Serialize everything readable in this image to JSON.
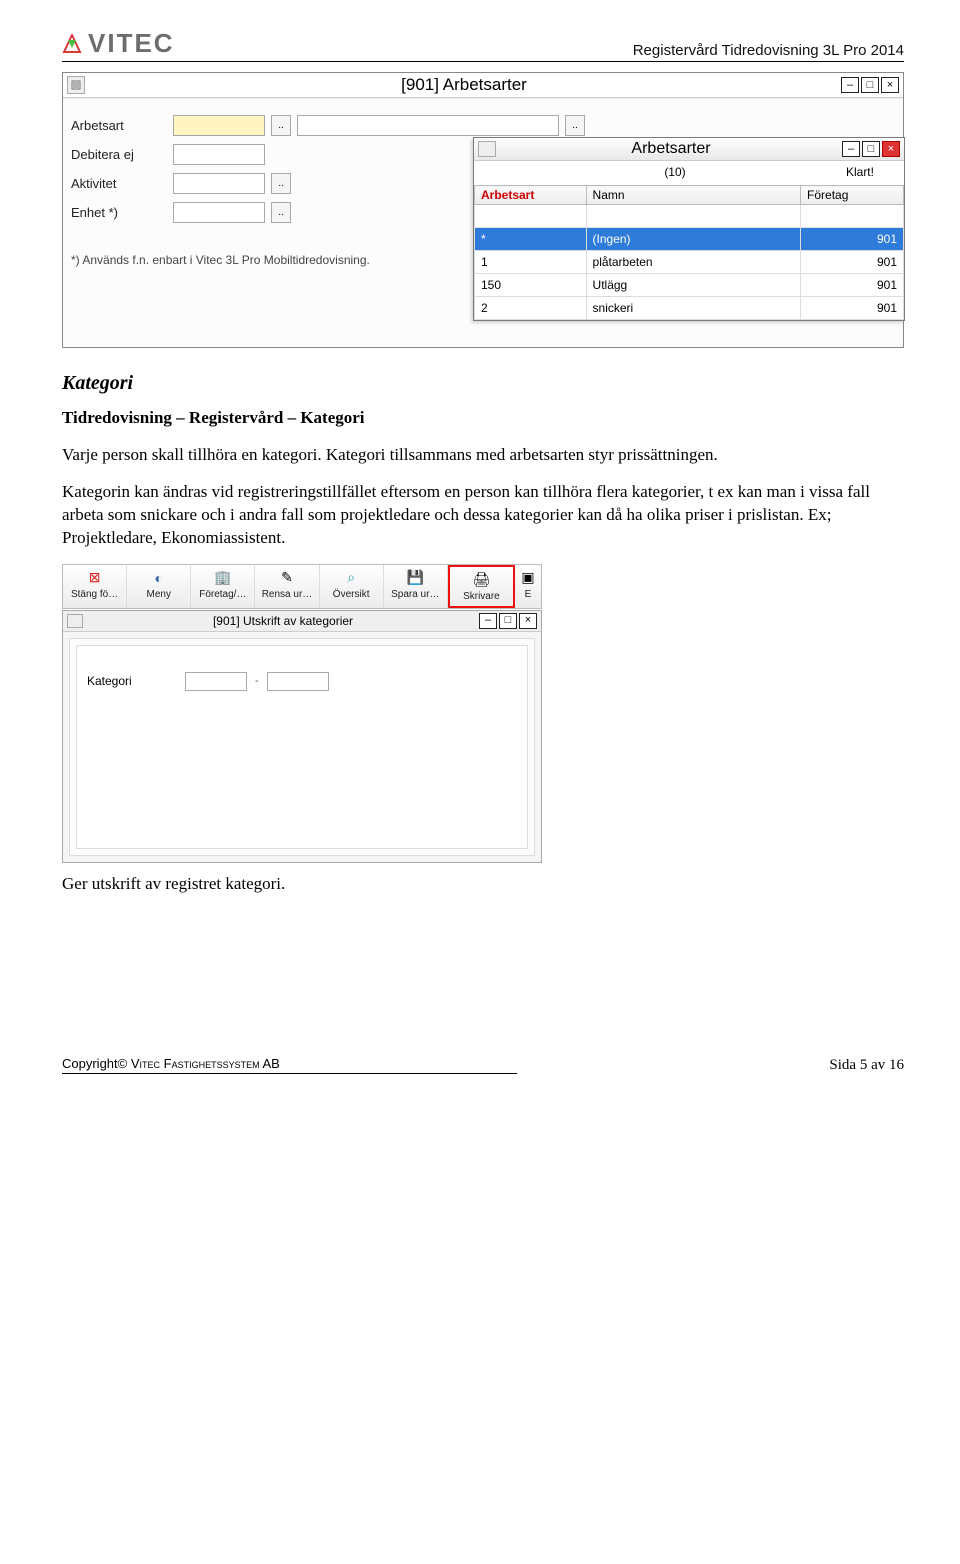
{
  "header": {
    "logo_text": "VITEC",
    "doc_title": "Registervård Tidredovisning 3L Pro 2014"
  },
  "win1": {
    "title": "[901]  Arbetsarter",
    "fields": {
      "arbetsart": "Arbetsart",
      "debitera": "Debitera ej",
      "aktivitet": "Aktivitet",
      "enhet": "Enhet *)"
    },
    "footnote": "*) Används f.n. enbart i Vitec 3L Pro Mobiltidredovisning."
  },
  "popup": {
    "title": "Arbetsarter",
    "count": "(10)",
    "status": "Klart!",
    "cols": {
      "c1": "Arbetsart",
      "c2": "Namn",
      "c3": "Företag"
    },
    "rows": [
      {
        "a": "*",
        "n": "(Ingen)",
        "f": "901",
        "sel": true
      },
      {
        "a": "1",
        "n": "plåtarbeten",
        "f": "901"
      },
      {
        "a": "150",
        "n": "Utlägg",
        "f": "901"
      },
      {
        "a": "2",
        "n": "snickeri",
        "f": "901"
      }
    ]
  },
  "doc": {
    "h3": "Kategori",
    "nav": "Tidredovisning – Registervård – Kategori",
    "p1": "Varje person skall tillhöra en kategori. Kategori tillsammans med arbetsarten styr prissättningen.",
    "p2": "Kategorin kan ändras vid registreringstillfället eftersom en person kan tillhöra flera kategorier, t ex kan man i vissa fall arbeta som snickare och i andra fall som projektledare och dessa kategorier kan då ha olika priser i prislistan. Ex; Projektledare, Ekonomiassistent.",
    "p3": "Ger utskrift av registret kategori."
  },
  "toolbar": {
    "t1": "Stäng fö…",
    "t2": "Meny",
    "t3": "Företag/…",
    "t4": "Rensa ur…",
    "t5": "Översikt",
    "t6": "Spara ur…",
    "t7": "Skrivare"
  },
  "printwin": {
    "title": "[901]  Utskrift av kategorier",
    "label": "Kategori",
    "dash": "-"
  },
  "footer": {
    "copyright": "Copyright©",
    "company": " Vitec Fastighetssystem AB",
    "page": "Sida 5 av 16"
  }
}
